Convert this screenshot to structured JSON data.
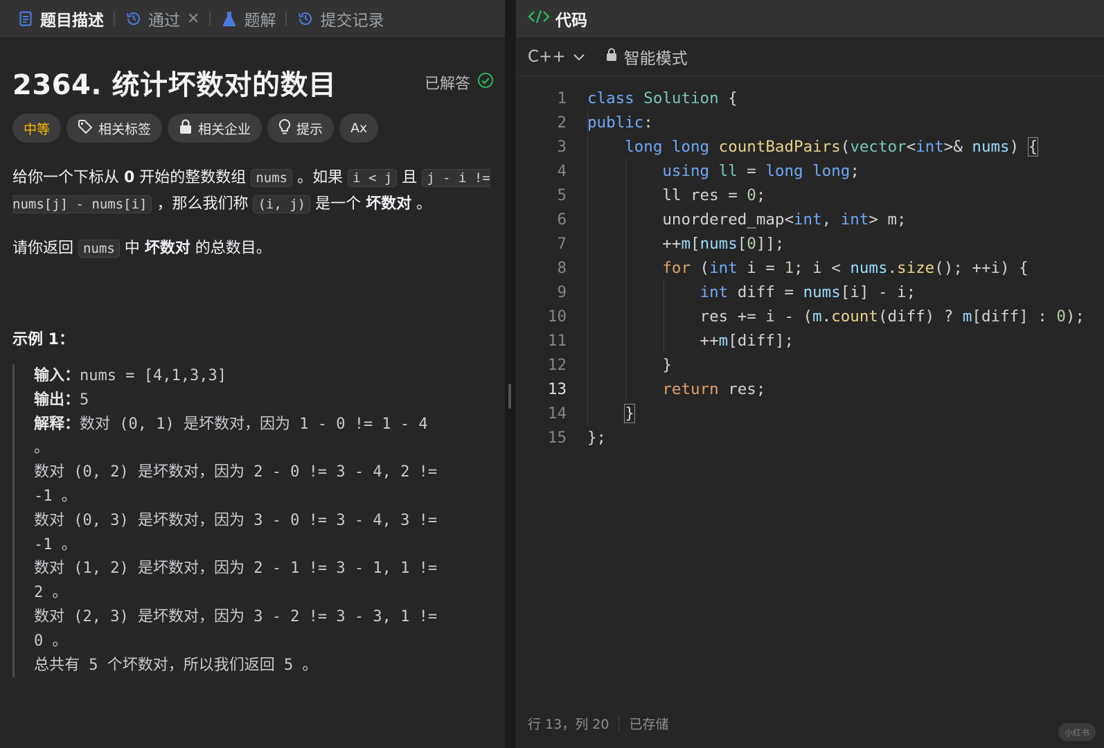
{
  "left_tabs": [
    {
      "label": "题目描述"
    },
    {
      "label": "通过"
    },
    {
      "label": "题解"
    },
    {
      "label": "提交记录"
    }
  ],
  "problem": {
    "title": "2364. 统计坏数对的数目",
    "status": "已解答",
    "difficulty": "中等",
    "tags": [
      "相关标签",
      "相关企业",
      "提示",
      "Ax"
    ]
  },
  "desc": {
    "p1_a": "给你一个下标从 ",
    "p1_zero": "0",
    "p1_b": " 开始的整数数组 ",
    "p1_code1": "nums",
    "p1_c": " 。如果 ",
    "p1_code2": "i < j",
    "p1_d": " 且 ",
    "p1_code3": "j - i != nums[j] - nums[i]",
    "p1_e": " ，那么我们称 ",
    "p1_code4": "(i, j)",
    "p1_f": " 是一个 ",
    "p1_bold": "坏数对",
    "p1_g": " 。",
    "p2_a": "请你返回 ",
    "p2_code": "nums",
    "p2_b": " 中 ",
    "p2_bold": "坏数对",
    "p2_c": " 的总数目。"
  },
  "example": {
    "title": "示例 1：",
    "input_label": "输入：",
    "input_value": "nums = [4,1,3,3]",
    "output_label": "输出：",
    "output_value": "5",
    "explain_label": "解释：",
    "lines": [
      "数对 (0, 1) 是坏数对，因为 1 - 0 != 1 - 4",
      "。",
      "数对 (0, 2) 是坏数对，因为 2 - 0 != 3 - 4, 2 !=",
      "-1 。",
      "数对 (0, 3) 是坏数对，因为 3 - 0 != 3 - 4, 3 !=",
      "-1 。",
      "数对 (1, 2) 是坏数对，因为 2 - 1 != 3 - 1, 1 !=",
      "2 。",
      "数对 (2, 3) 是坏数对，因为 3 - 2 != 3 - 3, 1 !=",
      "0 。",
      "总共有 5 个坏数对，所以我们返回 5 。"
    ]
  },
  "editor": {
    "tab_label": "代码",
    "language": "C++",
    "mode": "智能模式",
    "current_line": 13,
    "line_numbers": [
      "1",
      "2",
      "3",
      "4",
      "5",
      "6",
      "7",
      "8",
      "9",
      "10",
      "11",
      "12",
      "13",
      "14",
      "15"
    ]
  },
  "status": {
    "position": "行 13，列 20",
    "saved": "已存储",
    "watermark": "小红书"
  },
  "colors": {
    "accent_green": "#2db55d",
    "difficulty_medium": "#ffb800",
    "icon_blue": "#4a7bdc"
  }
}
